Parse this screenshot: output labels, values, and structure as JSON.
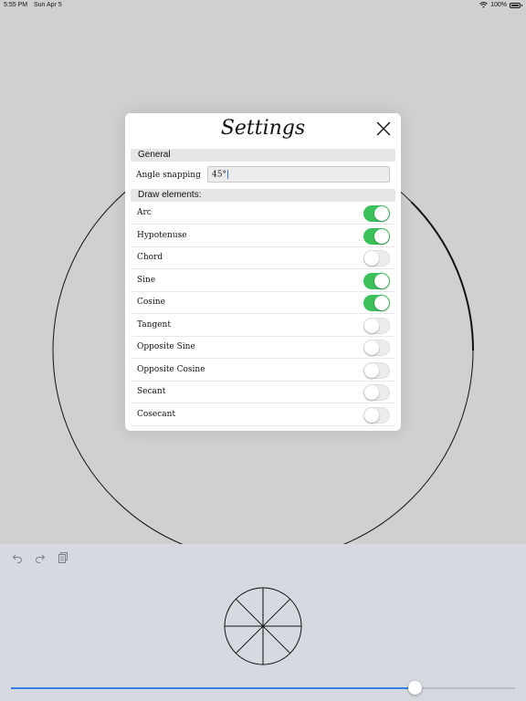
{
  "status_bar": {
    "time": "5:55 PM",
    "date": "Sun Apr 5",
    "battery": "100%"
  },
  "settings": {
    "title": "Settings",
    "general_header": "General",
    "angle_snapping_label": "Angle snapping",
    "angle_snapping_value": "45°",
    "draw_elements_header": "Draw elements:",
    "items": [
      {
        "label": "Arc",
        "on": true
      },
      {
        "label": "Hypotenuse",
        "on": true
      },
      {
        "label": "Chord",
        "on": false
      },
      {
        "label": "Sine",
        "on": true
      },
      {
        "label": "Cosine",
        "on": true
      },
      {
        "label": "Tangent",
        "on": false
      },
      {
        "label": "Opposite Sine",
        "on": false
      },
      {
        "label": "Opposite Cosine",
        "on": false
      },
      {
        "label": "Secant",
        "on": false
      },
      {
        "label": "Cosecant",
        "on": false
      }
    ]
  },
  "toolbar": {
    "icons": [
      "undo-icon",
      "redo-icon",
      "copy-icon"
    ]
  },
  "slider": {
    "fraction": 0.801
  },
  "colors": {
    "toggle_on": "#3bc15a",
    "slider_accent": "#2f7fe6",
    "background": "#d0d0d0",
    "panel": "#d6d9df"
  }
}
